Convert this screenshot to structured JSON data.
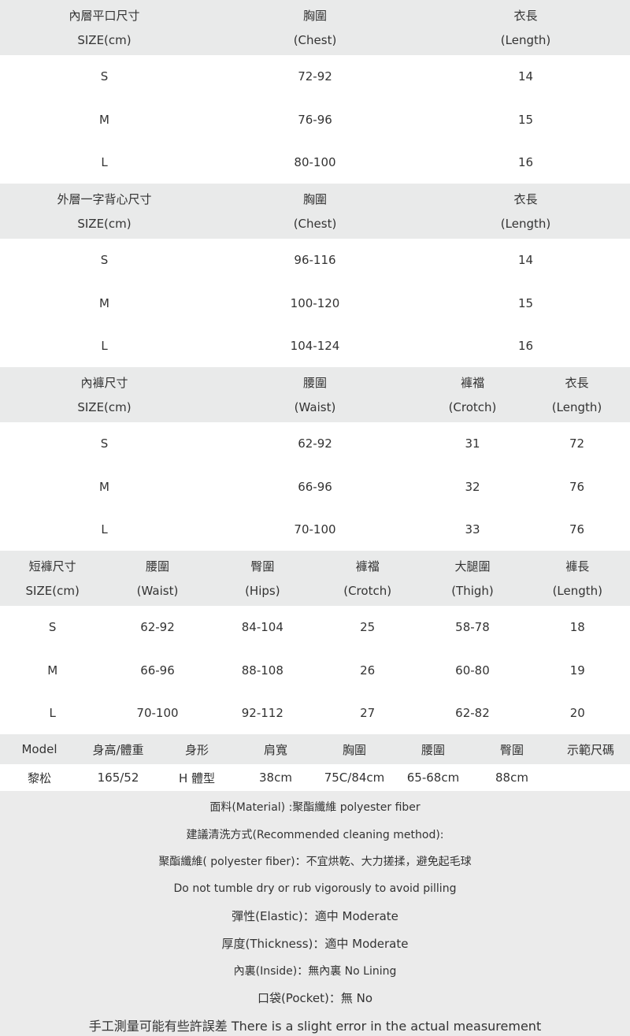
{
  "inner_bra": {
    "header1": [
      "內層平口尺寸",
      "胸圍",
      "衣長"
    ],
    "header2": [
      "SIZE(cm)",
      "(Chest)",
      "(Length)"
    ],
    "rows": [
      [
        "S",
        "72-92",
        "14"
      ],
      [
        "M",
        "76-96",
        "15"
      ],
      [
        "L",
        "80-100",
        "16"
      ]
    ]
  },
  "outer_vest": {
    "header1": [
      "外層一字背心尺寸",
      "胸圍",
      "衣長"
    ],
    "header2": [
      "SIZE(cm)",
      "(Chest)",
      "(Length)"
    ],
    "rows": [
      [
        "S",
        "96-116",
        "14"
      ],
      [
        "M",
        "100-120",
        "15"
      ],
      [
        "L",
        "104-124",
        "16"
      ]
    ]
  },
  "inner_pants": {
    "header1": [
      "內褲尺寸",
      "腰圍",
      "褲襠",
      "衣長"
    ],
    "header2": [
      "SIZE(cm)",
      "(Waist)",
      "(Crotch)",
      "(Length)"
    ],
    "rows": [
      [
        "S",
        "62-92",
        "31",
        "72"
      ],
      [
        "M",
        "66-96",
        "32",
        "76"
      ],
      [
        "L",
        "70-100",
        "33",
        "76"
      ]
    ]
  },
  "shorts": {
    "header1": [
      "短褲尺寸",
      "腰圍",
      "臀圍",
      "褲襠",
      "大腿圍",
      "褲長"
    ],
    "header2": [
      "SIZE(cm)",
      "(Waist)",
      "(Hips)",
      "(Crotch)",
      "(Thigh)",
      "(Length)"
    ],
    "rows": [
      [
        "S",
        "62-92",
        "84-104",
        "25",
        "58-78",
        "18"
      ],
      [
        "M",
        "66-96",
        "88-108",
        "26",
        "60-80",
        "19"
      ],
      [
        "L",
        "70-100",
        "92-112",
        "27",
        "62-82",
        "20"
      ]
    ]
  },
  "model": {
    "header": [
      "Model",
      "身高/體重",
      "身形",
      "肩寬",
      "胸圍",
      "腰圍",
      "臀圍",
      "示範尺碼"
    ],
    "row": [
      "黎松",
      "165/52",
      "H 體型",
      "38cm",
      "75C/84cm",
      "65-68cm",
      "88cm",
      ""
    ]
  },
  "notes": {
    "material": "面料(Material) :聚酯纖維  polyester fiber",
    "cleaning_title": "建議清洗方式(Recommended cleaning method):",
    "cleaning_zh": "聚酯纖維( polyester fiber)：不宜烘乾、大力搓揉，避免起毛球",
    "cleaning_en": "Do not tumble dry or rub vigorously to avoid pilling",
    "elastic": "彈性(Elastic)：適中 Moderate",
    "thickness": "厚度(Thickness)：適中 Moderate",
    "inside": "內裏(Inside)：無內裏 No Lining",
    "pocket": "口袋(Pocket)：無 No",
    "error": "手工測量可能有些許誤差  There is a slight error in the actual measurement"
  }
}
